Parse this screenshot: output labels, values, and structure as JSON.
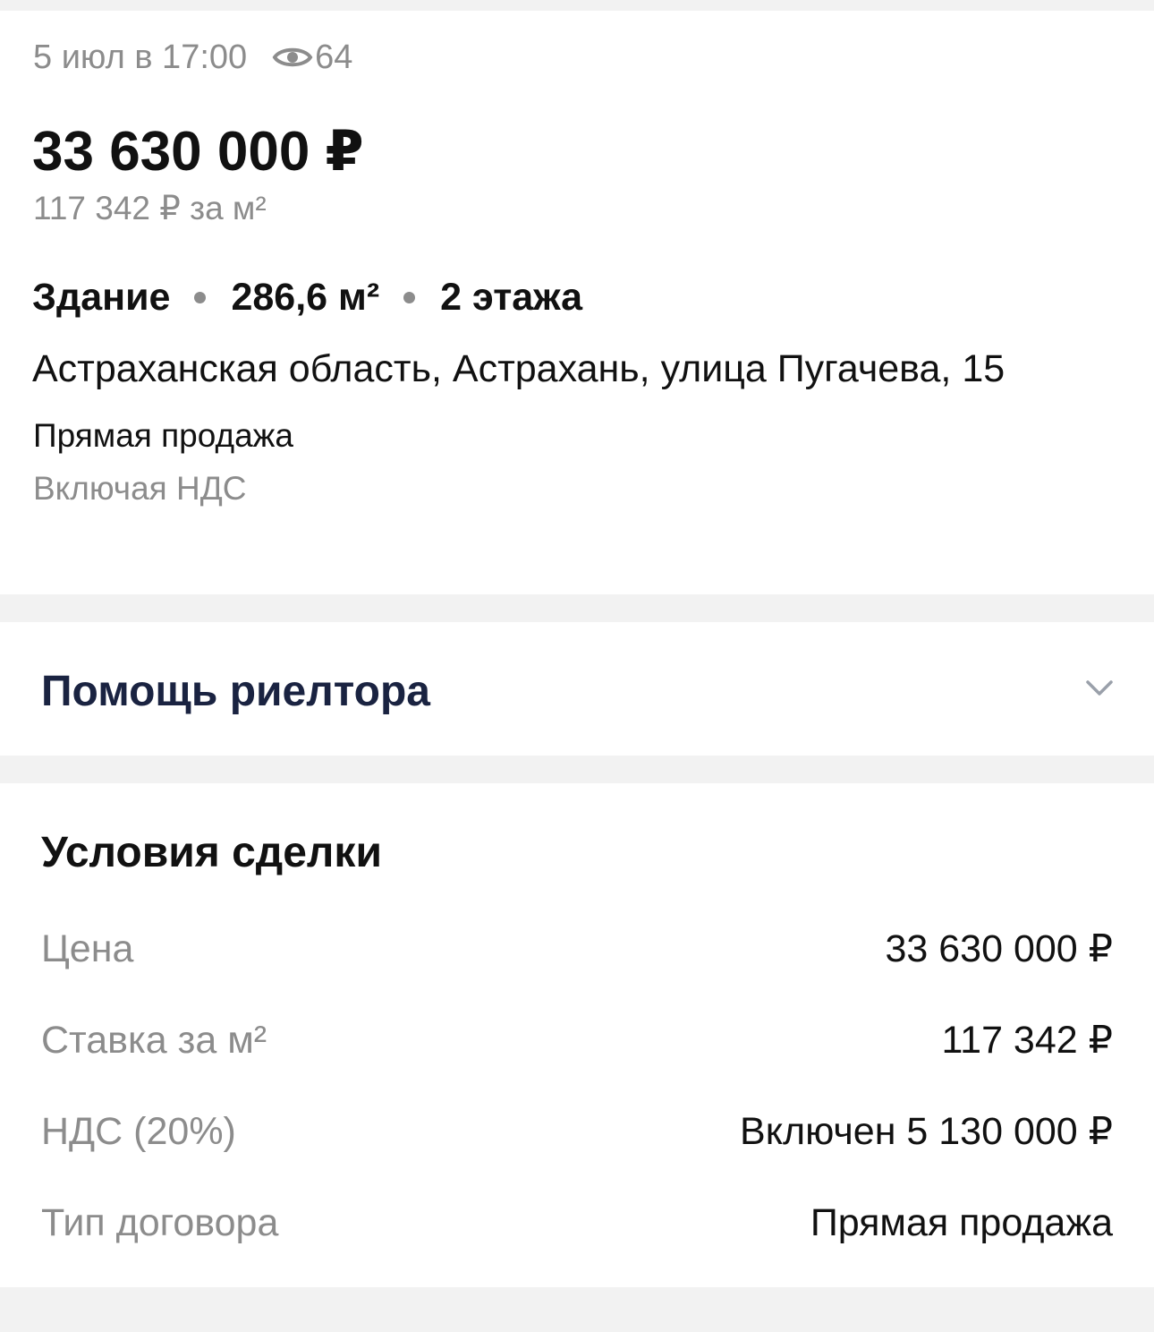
{
  "listing": {
    "date": "5 июл в 17:00",
    "views": "64",
    "price": "33 630 000 ₽",
    "price_per_m2": "117 342 ₽ за м²",
    "features": [
      "Здание",
      "286,6 м²",
      "2 этажа"
    ],
    "address": "Астраханская область, Астрахань, улица Пугачева, 15",
    "sale_type": "Прямая продажа",
    "vat_note": "Включая НДС"
  },
  "help": {
    "title": "Помощь риелтора",
    "icon": "chevron-down-icon"
  },
  "deal": {
    "title": "Условия сделки",
    "rows": [
      {
        "label": "Цена",
        "value": "33 630 000 ₽"
      },
      {
        "label": "Ставка за м²",
        "value": "117 342 ₽"
      },
      {
        "label": "НДС (20%)",
        "value": "Включен 5 130 000 ₽"
      },
      {
        "label": "Тип договора",
        "value": "Прямая продажа"
      }
    ]
  },
  "colors": {
    "background": "#f2f2f2",
    "card": "#ffffff",
    "text_primary": "#111111",
    "text_secondary": "#8c8c8c",
    "help_title": "#1a2341"
  }
}
